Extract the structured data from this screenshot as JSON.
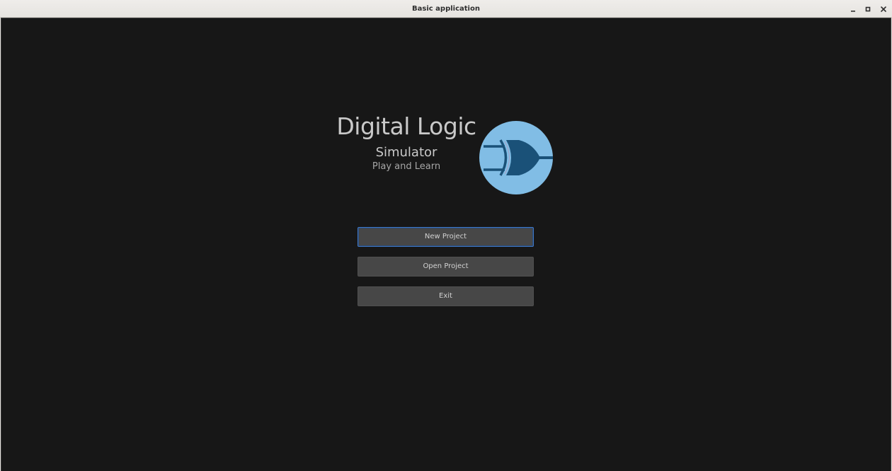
{
  "window": {
    "title": "Basic application",
    "controls": {
      "minimize_icon": "minimize-icon",
      "maximize_icon": "maximize-icon",
      "close_icon": "close-icon"
    }
  },
  "splash": {
    "title": "Digital Logic",
    "subtitle": "Simulator",
    "tagline": "Play and Learn",
    "logo_icon": "xor-gate-icon"
  },
  "menu": {
    "new_project": "New Project",
    "open_project": "Open Project",
    "exit": "Exit",
    "focused": "New Project"
  },
  "colors": {
    "background": "#171717",
    "button": "#474747",
    "button_text": "#d2d2d2",
    "focus_border": "#3f78c7",
    "logo_circle": "#81bde5",
    "logo_gate": "#1a5178"
  }
}
